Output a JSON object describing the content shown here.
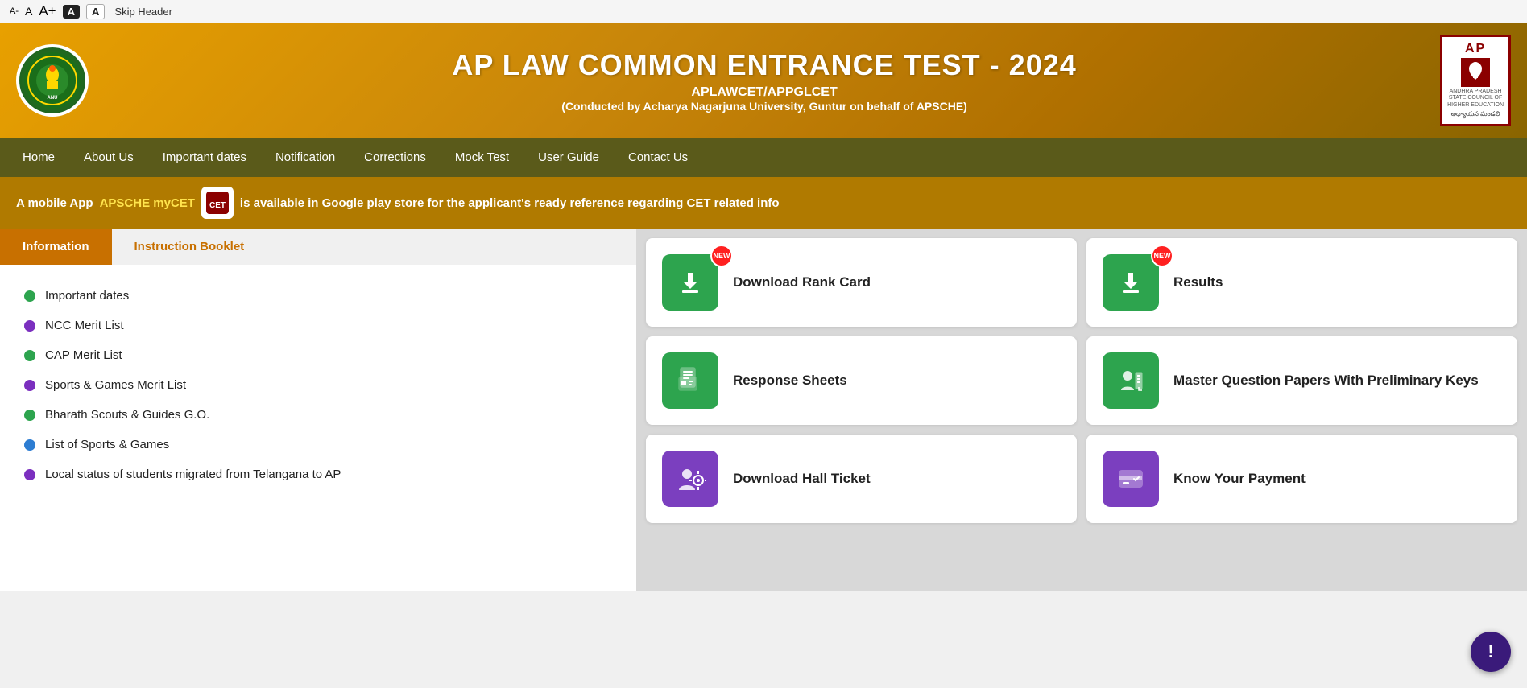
{
  "access": {
    "a_minus": "A-",
    "a_normal": "A",
    "a_plus": "A+",
    "btn_black_label": "A",
    "btn_white_label": "A",
    "skip_label": "Skip Header"
  },
  "header": {
    "title": "AP LAW COMMON ENTRANCE TEST - 2024",
    "subtitle": "APLAWCET/APPGLCET",
    "conducted": "(Conducted by Acharya Nagarjuna University, Guntur on behalf of APSCHE)",
    "logo_left_alt": "University Logo",
    "logo_right_alt": "APSCHE Logo",
    "apsche_text": "APSCHE"
  },
  "nav": {
    "items": [
      {
        "label": "Home",
        "id": "home"
      },
      {
        "label": "About Us",
        "id": "about"
      },
      {
        "label": "Important dates",
        "id": "dates"
      },
      {
        "label": "Notification",
        "id": "notification"
      },
      {
        "label": "Corrections",
        "id": "corrections"
      },
      {
        "label": "Mock Test",
        "id": "mock"
      },
      {
        "label": "User Guide",
        "id": "userguide"
      },
      {
        "label": "Contact Us",
        "id": "contact"
      }
    ]
  },
  "banner": {
    "prefix": "A mobile App ",
    "app_name": "APSCHE myCET",
    "suffix": " is available in Google play store for the applicant's ready reference regarding CET related info"
  },
  "tabs": {
    "tab1": "Information",
    "tab2": "Instruction Booklet"
  },
  "info_items": [
    {
      "label": "Important dates",
      "dot": "green"
    },
    {
      "label": "NCC Merit List",
      "dot": "purple"
    },
    {
      "label": "CAP Merit List",
      "dot": "green"
    },
    {
      "label": "Sports & Games Merit List",
      "dot": "purple"
    },
    {
      "label": "Bharath Scouts & Guides G.O.",
      "dot": "green"
    },
    {
      "label": "List of Sports & Games",
      "dot": "blue"
    },
    {
      "label": "Local status of students migrated from Telangana to AP",
      "dot": "purple"
    }
  ],
  "cards": [
    {
      "label": "Download Rank Card",
      "icon": "download",
      "color": "green",
      "new": true,
      "id": "rank-card"
    },
    {
      "label": "Results",
      "icon": "download",
      "color": "green",
      "new": true,
      "id": "results"
    },
    {
      "label": "Response Sheets",
      "icon": "sheet",
      "color": "green",
      "new": false,
      "id": "response-sheets"
    },
    {
      "label": "Master Question Papers With Preliminary Keys",
      "icon": "person-table",
      "color": "green",
      "new": false,
      "id": "master-question"
    },
    {
      "label": "Download Hall Ticket",
      "icon": "hall-ticket",
      "color": "purple",
      "new": false,
      "id": "hall-ticket"
    },
    {
      "label": "Know Your Payment",
      "icon": "payment",
      "color": "purple",
      "new": false,
      "id": "payment"
    }
  ],
  "notif_btn": "!"
}
